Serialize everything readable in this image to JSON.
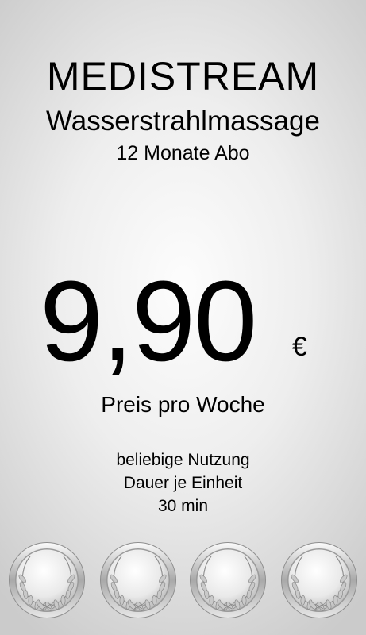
{
  "brand": "MEDISTREAM",
  "product": "Wasserstrahlmassage",
  "subscription": "12 Monate Abo",
  "price": {
    "amount": "9,90",
    "currency": "€",
    "unit": "Preis pro Woche"
  },
  "details": {
    "usage": "beliebige Nutzung",
    "duration_label": "Dauer je Einheit",
    "duration": "30 min"
  },
  "medals": [
    {
      "icon": "laurel-wreath-medal-icon"
    },
    {
      "icon": "laurel-wreath-medal-icon"
    },
    {
      "icon": "laurel-wreath-medal-icon"
    },
    {
      "icon": "laurel-wreath-medal-icon"
    }
  ],
  "colors": {
    "text": "#000000",
    "background_center": "#fdfdfd",
    "background_edge": "#cbcbcb",
    "medal_silver": "#c8c8c8"
  }
}
